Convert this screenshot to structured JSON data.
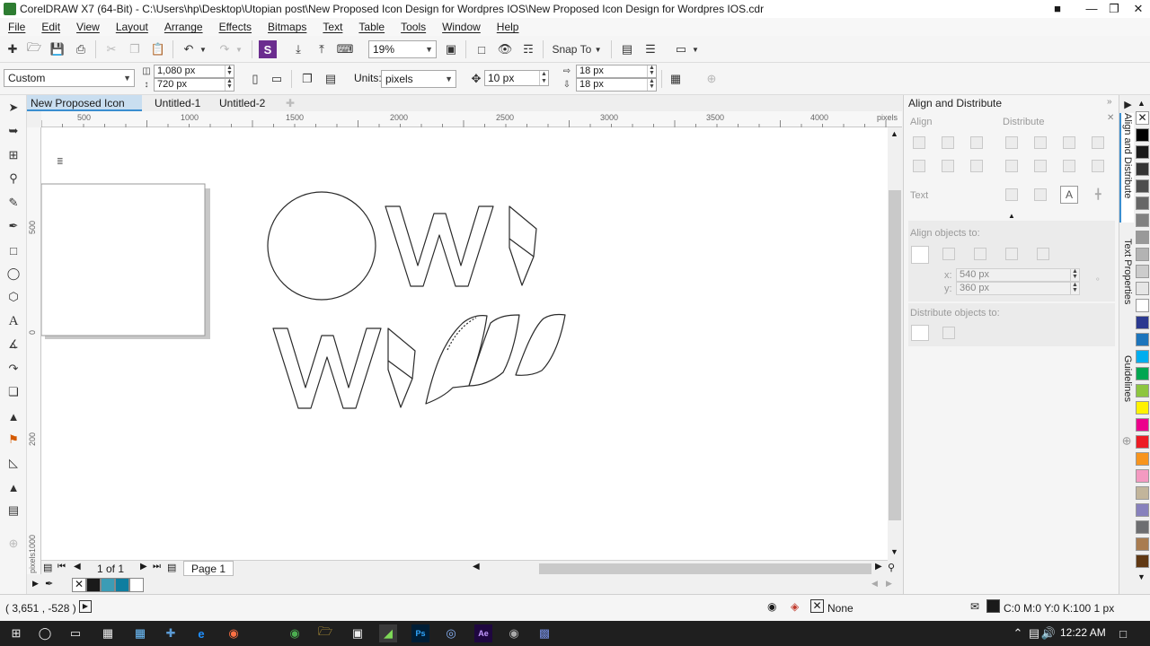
{
  "window": {
    "title": "CorelDRAW X7 (64-Bit) - C:\\Users\\hp\\Desktop\\Utopian post\\New Proposed Icon Design for Wordpres IOS\\New Proposed Icon Design for Wordpres IOS.cdr",
    "minimize": "—",
    "restore": "❐",
    "close": "✕"
  },
  "menu": [
    "File",
    "Edit",
    "View",
    "Layout",
    "Arrange",
    "Effects",
    "Bitmaps",
    "Text",
    "Table",
    "Tools",
    "Window",
    "Help"
  ],
  "toolbar": {
    "zoom": "19%",
    "snap_to": "Snap To"
  },
  "property_bar": {
    "page_preset": "Custom",
    "width": "1,080 px",
    "height": "720 px",
    "units_label": "Units:",
    "units": "pixels",
    "nudge": "10 px",
    "dup_x": "18 px",
    "dup_y": "18 px"
  },
  "tabs": [
    "New Proposed Icon De...",
    "Untitled-1",
    "Untitled-2"
  ],
  "ruler": {
    "h_labels": [
      "500",
      "1000",
      "1500",
      "2000",
      "2500",
      "3000",
      "3500",
      "4000"
    ],
    "h_unit": "pixels",
    "v_labels": [
      "500",
      "0",
      "200",
      "1000"
    ],
    "v_unit": "pixels"
  },
  "page_nav": {
    "counter": "1 of 1",
    "page_tab": "Page 1"
  },
  "status": {
    "coords": "( 3,651 , -528 )",
    "fill": "None",
    "outline": "C:0 M:0 Y:0 K:100  1 px"
  },
  "docker": {
    "title": "Align and Distribute",
    "align": "Align",
    "distribute": "Distribute",
    "text": "Text",
    "align_objects_to": "Align objects to:",
    "x_label": "x:",
    "x_value": "540 px",
    "y_label": "y:",
    "y_value": "360 px",
    "distribute_objects_to": "Distribute objects to:"
  },
  "side_tabs": [
    "Align and Distribute",
    "Text Properties",
    "Guidelines"
  ],
  "palette": [
    "#ffffff",
    "#000000",
    "#1a1a1a",
    "#333333",
    "#4d4d4d",
    "#666666",
    "#808080",
    "#999999",
    "#b3b3b3",
    "#cccccc",
    "#e6e6e6",
    "#ffffff",
    "#2b3990",
    "#1c75bc",
    "#00aeef",
    "#00a651",
    "#8dc63f",
    "#fff200",
    "#ec008c",
    "#ed1c24",
    "#f7941d",
    "#f49ac1",
    "#c2b59b",
    "#8781bd",
    "#6d6e71",
    "#a97c50",
    "#603813"
  ],
  "doc_colors": [
    "#1a1a1a",
    "#3c9cb5",
    "#0f7ea0",
    "#ffffff"
  ],
  "clock": {
    "time": "12:22 AM"
  }
}
